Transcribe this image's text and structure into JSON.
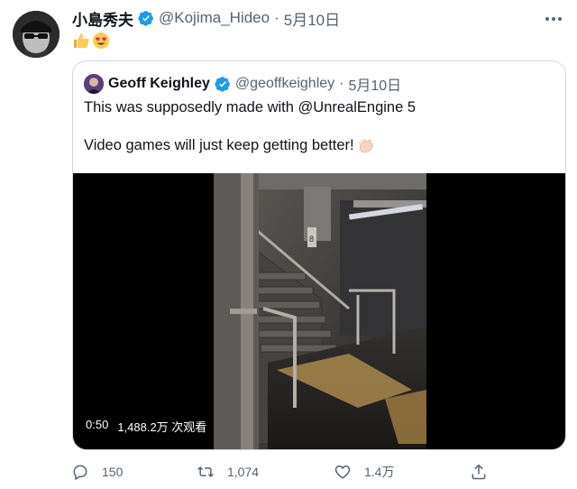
{
  "tweet": {
    "author_name": "小島秀夫",
    "handle": "@Kojima_Hideo",
    "separator": "·",
    "date": "5月10日"
  },
  "quoted": {
    "author_name": "Geoff Keighley",
    "handle": "@geoffkeighley",
    "separator": "·",
    "date": "5月10日",
    "line1": "This was supposedly made with @UnrealEngine 5",
    "line2": "Video games will just keep getting better!"
  },
  "video": {
    "duration": "0:50",
    "views": "1,488.2万 次观看"
  },
  "actions": {
    "replies": "150",
    "retweets": "1,074",
    "likes": "1.4万"
  },
  "colors": {
    "verified": "#1d9bf0",
    "text": "#0f1419",
    "muted": "#536471",
    "border": "#cfd9de"
  },
  "icons": [
    "verified-badge-icon",
    "more-icon",
    "thumbs-up-emoji",
    "heart-eyes-emoji",
    "clapping-hands-emoji",
    "reply-icon",
    "retweet-icon",
    "like-icon",
    "share-icon"
  ]
}
